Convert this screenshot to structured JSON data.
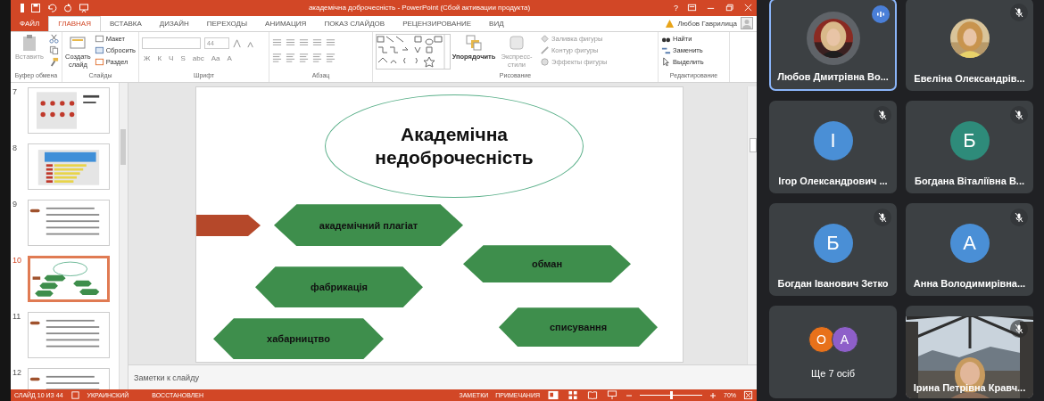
{
  "window": {
    "title": "академічна доброчесність - PowerPoint (Сбой активации продукта)",
    "help": "?",
    "user": "Любов Гаврилица"
  },
  "ribbon_tabs": [
    {
      "label": "ФАЙЛ",
      "kind": "file",
      "selected": false
    },
    {
      "label": "ГЛАВНАЯ",
      "kind": "tab",
      "selected": true
    },
    {
      "label": "ВСТАВКА",
      "kind": "tab",
      "selected": false
    },
    {
      "label": "ДИЗАЙН",
      "kind": "tab",
      "selected": false
    },
    {
      "label": "ПЕРЕХОДЫ",
      "kind": "tab",
      "selected": false
    },
    {
      "label": "АНИМАЦИЯ",
      "kind": "tab",
      "selected": false
    },
    {
      "label": "ПОКАЗ СЛАЙДОВ",
      "kind": "tab",
      "selected": false
    },
    {
      "label": "РЕЦЕНЗИРОВАНИЕ",
      "kind": "tab",
      "selected": false
    },
    {
      "label": "ВИД",
      "kind": "tab",
      "selected": false
    }
  ],
  "ribbon": {
    "clipboard": {
      "paste": "Вставить",
      "label": "Буфер обмена"
    },
    "slides": {
      "new_slide": "Создать слайд",
      "layout": "Макет",
      "reset": "Сбросить",
      "section": "Раздел",
      "label": "Слайды"
    },
    "font": {
      "size": "44",
      "format_buttons": [
        "Ж",
        "К",
        "Ч",
        "S",
        "abc",
        "Aa"
      ],
      "color_button": "A",
      "label": "Шрифт"
    },
    "paragraph": {
      "label": "Абзац"
    },
    "drawing": {
      "arrange": "Упорядочить",
      "quick_styles": "Экспресс-стили",
      "shape_fill": "Заливка фигуры",
      "shape_outline": "Контур фигуры",
      "shape_effects": "Эффекты фигуры",
      "label": "Рисование"
    },
    "editing": {
      "find": "Найти",
      "replace": "Заменить",
      "select": "Выделить",
      "label": "Редактирование"
    }
  },
  "thumbnails": [
    {
      "number": "7",
      "kind": "infographic",
      "selected": false
    },
    {
      "number": "8",
      "kind": "chart",
      "selected": false
    },
    {
      "number": "9",
      "kind": "text",
      "selected": false
    },
    {
      "number": "10",
      "kind": "diagram",
      "selected": true
    },
    {
      "number": "11",
      "kind": "text",
      "selected": false
    },
    {
      "number": "12",
      "kind": "text",
      "selected": false
    }
  ],
  "slide": {
    "title": "Академічна недоброчесність",
    "shapes": [
      {
        "label": "академічний плагіат"
      },
      {
        "label": "обман"
      },
      {
        "label": "фабрикація"
      },
      {
        "label": "списування"
      },
      {
        "label": "хабарництво"
      }
    ]
  },
  "notes": {
    "placeholder": "Заметки к слайду"
  },
  "status_bar": {
    "slide": "СЛАЙД 10 ИЗ 44",
    "language": "УКРАИНСКИЙ",
    "state": "ВОССТАНОВЛЕН",
    "notes": "ЗАМЕТКИ",
    "comments": "ПРИМЕЧАНИЯ",
    "zoom": "70%",
    "zoom_slider": {
      "level": 0.5
    }
  },
  "participants": [
    {
      "name": "Любов Дмитрівна Во...",
      "speaking": true,
      "muted": false,
      "selected": true
    },
    {
      "name": "Евеліна Олександрів...",
      "speaking": false,
      "muted": true,
      "selected": false
    },
    {
      "name": "Ігор Олександрович ...",
      "kind": "initial",
      "initial": "І",
      "color": "#4a8fd6",
      "speaking": false,
      "muted": true,
      "selected": false
    },
    {
      "name": "Богдана Віталіївна В...",
      "kind": "initial",
      "initial": "Б",
      "color": "#2e8b7a",
      "speaking": false,
      "muted": true,
      "selected": false
    },
    {
      "name": "Богдан Іванович Зетко",
      "kind": "initial",
      "initial": "Б",
      "color": "#4a8fd6",
      "speaking": false,
      "muted": true,
      "selected": false
    },
    {
      "name": "Анна Володимирівна...",
      "kind": "initial",
      "initial": "А",
      "color": "#4a8fd6",
      "speaking": false,
      "muted": true,
      "selected": false
    },
    {
      "name": "Ще 7 осіб",
      "kind": "more",
      "avatars": [
        {
          "initial": "О",
          "color": "#e8711a"
        },
        {
          "initial": "А",
          "color": "#8e5fc9"
        }
      ],
      "speaking": false,
      "muted": false,
      "selected": false
    },
    {
      "name": "Ірина Петрівна Кравч...",
      "kind": "video",
      "speaking": false,
      "muted": true,
      "selected": false
    }
  ]
}
